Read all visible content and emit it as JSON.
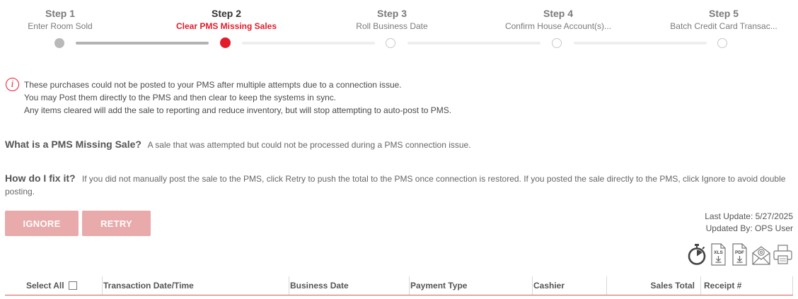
{
  "stepper": {
    "steps": [
      {
        "title": "Step 1",
        "label": "Enter Room Sold",
        "state": "done"
      },
      {
        "title": "Step 2",
        "label": "Clear PMS Missing Sales",
        "state": "active"
      },
      {
        "title": "Step 3",
        "label": "Roll Business Date",
        "state": "todo"
      },
      {
        "title": "Step 4",
        "label": "Confirm House Account(s)...",
        "state": "todo"
      },
      {
        "title": "Step 5",
        "label": "Batch Credit Card Transac...",
        "state": "todo"
      }
    ]
  },
  "notice": {
    "icon": "info-icon",
    "lines": [
      "These purchases could not be posted to your PMS after multiple attempts due to a connection issue.",
      "You may Post them directly to the PMS and then clear to keep the systems in sync.",
      "Any items cleared will add the sale to reporting and reduce inventory, but will stop attempting to auto-post to PMS."
    ]
  },
  "faq": {
    "what_q": "What is a PMS Missing Sale?",
    "what_a": "A sale that was attempted but could not be processed during a PMS connection issue.",
    "how_q": "How do I fix it?",
    "how_a": "If you did not manually post the sale to the PMS, click Retry to push the total to the PMS once connection is restored. If you posted the sale directly to the PMS, click Ignore to avoid double posting."
  },
  "actions": {
    "ignore_label": "IGNORE",
    "retry_label": "RETRY"
  },
  "meta": {
    "last_update": "Last Update: 5/27/2025",
    "updated_by": "Updated By: OPS User"
  },
  "toolbar": {
    "icons": [
      "stopwatch-icon",
      "xls-export-icon",
      "pdf-export-icon",
      "email-icon",
      "print-icon"
    ],
    "xls_text": "XLS",
    "pdf_text": "PDF"
  },
  "table": {
    "select_all": "Select All",
    "columns": [
      "Transaction Date/Time",
      "Business Date",
      "Payment Type",
      "Cashier",
      "Sales Total",
      "Receipt #"
    ]
  },
  "colors": {
    "accent": "#e31c2b",
    "button": "#e8aaaa",
    "done": "#b3b3b3"
  }
}
